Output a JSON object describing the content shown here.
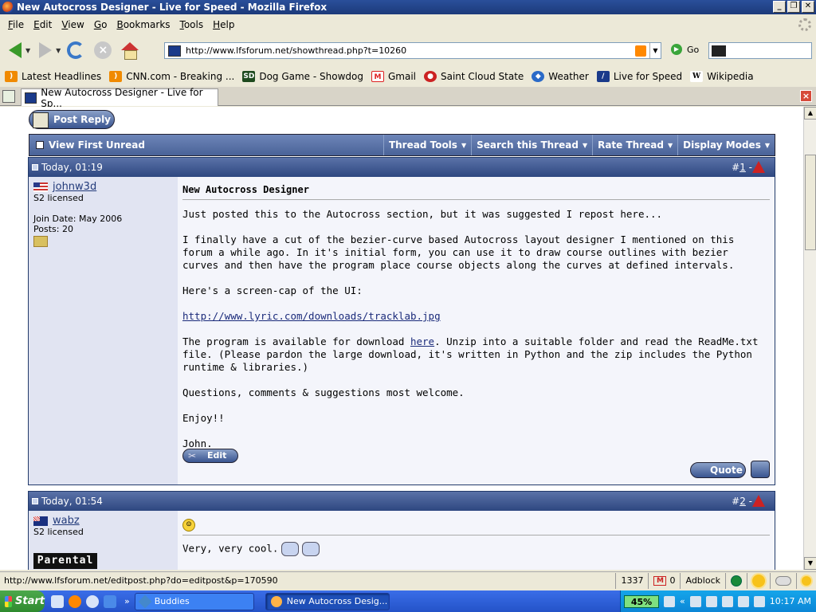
{
  "window": {
    "title": "New Autocross Designer - Live for Speed - Mozilla Firefox",
    "controls": [
      "_",
      "❐",
      "✕"
    ]
  },
  "menu": [
    "File",
    "Edit",
    "View",
    "Go",
    "Bookmarks",
    "Tools",
    "Help"
  ],
  "nav": {
    "url": "http://www.lfsforum.net/showthread.php?t=10260",
    "go_label": "Go",
    "search_value": ""
  },
  "bookmarks": [
    {
      "label": "Latest Headlines",
      "icon": "rss-icon",
      "color": "#f08a00"
    },
    {
      "label": "CNN.com - Breaking ...",
      "icon": "rss-icon",
      "color": "#f08a00"
    },
    {
      "label": "Dog Game - Showdog",
      "icon": "sd-icon",
      "color": "#1e4a1e"
    },
    {
      "label": "Gmail",
      "icon": "gmail-icon",
      "color": "#d22"
    },
    {
      "label": "Saint Cloud State",
      "icon": "scsu-icon",
      "color": "#c22"
    },
    {
      "label": "Weather",
      "icon": "noaa-icon",
      "color": "#2a6ac8"
    },
    {
      "label": "Live for Speed",
      "icon": "lfs-icon",
      "color": "#1a3a8a"
    },
    {
      "label": "Wikipedia",
      "icon": "wikipedia-icon",
      "color": "#555"
    }
  ],
  "tab": {
    "label": "New Autocross Designer - Live for Sp..."
  },
  "forum": {
    "post_reply": "Post Reply",
    "toolbar": {
      "first_unread": "View First Unread",
      "thread_tools": "Thread Tools",
      "search_thread": "Search this Thread",
      "rate_thread": "Rate Thread",
      "display_modes": "Display Modes"
    },
    "post1": {
      "date": "Today, 01:19",
      "number_prefix": "#",
      "number": "1",
      "number_suffix": " -",
      "user": "johnw3d",
      "license": "S2 licensed",
      "join_date": "Join Date: May 2006",
      "posts": "Posts: 20",
      "title": "New Autocross Designer",
      "p1": "Just posted this to the Autocross section, but it was suggested I repost here...",
      "p2": "I finally have a cut of the bezier-curve based Autocross layout designer I mentioned on this forum a while ago. In it's initial form, you can use it to draw course outlines with bezier curves and then have the program place course objects along the curves at defined intervals.",
      "p3": "Here's a screen-cap of the UI:",
      "link": "http://www.lyric.com/downloads/tracklab.jpg",
      "p4_pre": "The program is available for download ",
      "p4_link": "here",
      "p4_post": ". Unzip into a suitable folder and read the ReadMe.txt file. (Please pardon the large download, it's written in Python and the zip includes the Python runtime & libraries.)",
      "p5": "Questions, comments & suggestions most welcome.",
      "p6": "Enjoy!!",
      "sig": "John.",
      "edit_label": "Edit",
      "quote_label": "Quote"
    },
    "post2": {
      "date": "Today, 01:54",
      "number_prefix": "#",
      "number": "2",
      "number_suffix": " -",
      "user": "wabz",
      "license": "S2 licensed",
      "badge": "Parental",
      "smiley": "☺",
      "text": "Very, very cool."
    }
  },
  "status": {
    "text": "http://www.lfsforum.net/editpost.php?do=editpost&p=170590",
    "count": "1337",
    "gmail_count": "0",
    "adblock": "Adblock"
  },
  "taskbar": {
    "start": "Start",
    "chevron": "»",
    "task1": "Buddies",
    "task2": "New Autocross Desig...",
    "tray_chevron": "«",
    "battery": "45%",
    "clock": "10:17 AM"
  }
}
